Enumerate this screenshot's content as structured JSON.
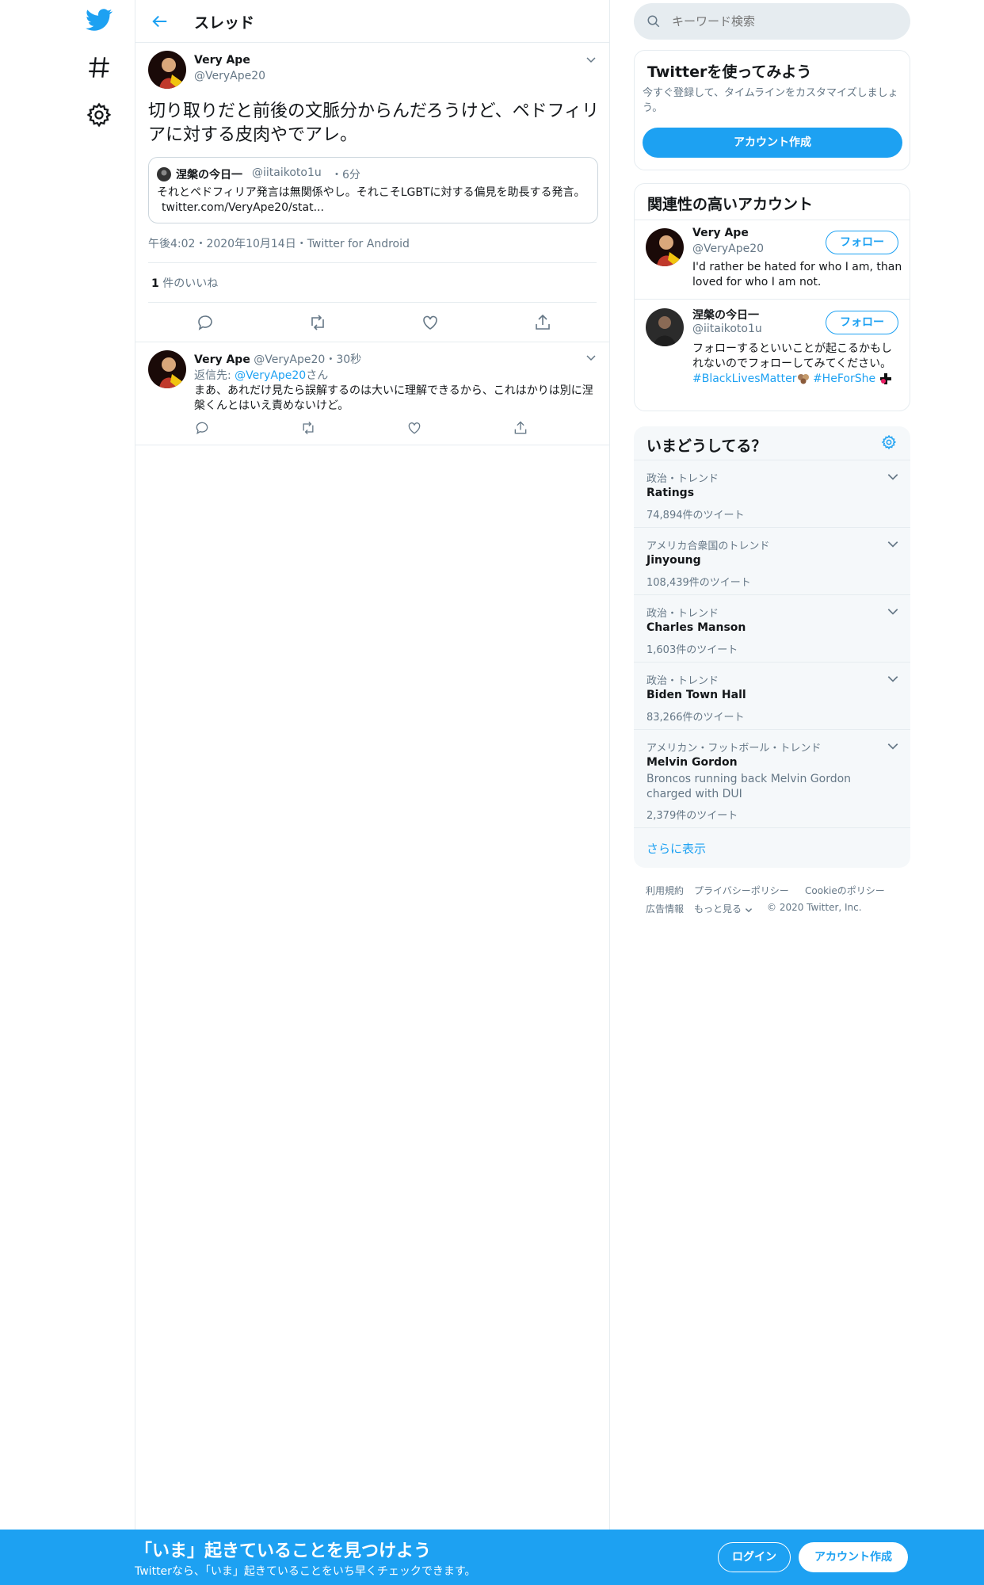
{
  "nav": {
    "items": [
      "twitter-logo",
      "explore-hashtag",
      "settings"
    ]
  },
  "header": {
    "title": "スレッド"
  },
  "main_tweet": {
    "name": "Very Ape",
    "handle": "@VeryApe20",
    "text": "切り取りだと前後の文脈分からんだろうけど、ペドフィリアに対する皮肉やでアレ。",
    "quote": {
      "name": "涅槃の今日一",
      "handle": "@iitaikoto1u",
      "time": "・6分",
      "text": "それとペドフィリア発言は無関係やし。それこそLGBTに対する偏見を助長する発言。",
      "link": "twitter.com/VeryApe20/stat..."
    },
    "meta": "午後4:02・2020年10月14日・Twitter for Android",
    "likes_count": "1",
    "likes_label": "件のいいね"
  },
  "reply": {
    "name": "Very Ape",
    "handle": "@VeryApe20",
    "time": "・30秒",
    "reply_to_prefix": "返信先:",
    "reply_to_handle": "@VeryApe20",
    "reply_to_suffix": "さん",
    "text": "まあ、あれだけ見たら誤解するのは大いに理解できるから、これはかりは別に涅槃くんとはいえ責めないけど。"
  },
  "search": {
    "placeholder": "キーワード検索"
  },
  "signup_card": {
    "title": "Twitterを使ってみよう",
    "desc": "今すぐ登録して、タイムラインをカスタマイズしましょう。",
    "button": "アカウント作成"
  },
  "related": {
    "title": "関連性の高いアカウント",
    "accounts": [
      {
        "name": "Very Ape",
        "handle": "@VeryApe20",
        "follow": "フォロー",
        "bio": "I'd rather be hated for who I am, than loved for who I am not."
      },
      {
        "name": "涅槃の今日一",
        "handle": "@iitaikoto1u",
        "follow": "フォロー",
        "bio": "フォローするといいことが起こるかもしれないのでフォローしてみてください。",
        "tag1": "#BlackLivesMatter",
        "tag2": "#HeForShe"
      }
    ]
  },
  "trends": {
    "title": "いまどうしてる？",
    "items": [
      {
        "category": "政治・トレンド",
        "name": "Ratings",
        "count": "74,894件のツイート"
      },
      {
        "category": "アメリカ合衆国のトレンド",
        "name": "Jinyoung",
        "count": "108,439件のツイート"
      },
      {
        "category": "政治・トレンド",
        "name": "Charles Manson",
        "count": "1,603件のツイート"
      },
      {
        "category": "政治・トレンド",
        "name": "Biden Town Hall",
        "count": "83,266件のツイート"
      },
      {
        "category": "アメリカン・フットボール・トレンド",
        "name": "Melvin Gordon",
        "desc": "Broncos running back Melvin Gordon charged with DUI",
        "count": "2,379件のツイート"
      }
    ],
    "show_more": "さらに表示"
  },
  "footer": {
    "terms": "利用規約",
    "privacy": "プライバシーポリシー",
    "cookie": "Cookieのポリシー",
    "ads": "広告情報",
    "more": "もっと見る",
    "copyright": "© 2020 Twitter, Inc."
  },
  "banner": {
    "title": "「いま」起きていることを見つけよう",
    "subtitle": "Twitterなら、「いま」起きていることをいち早くチェックできます。",
    "login": "ログイン",
    "signup": "アカウント作成"
  },
  "colors": {
    "accent": "#1da1f2",
    "secondary_text": "#657786",
    "border": "#e6ecf0"
  }
}
